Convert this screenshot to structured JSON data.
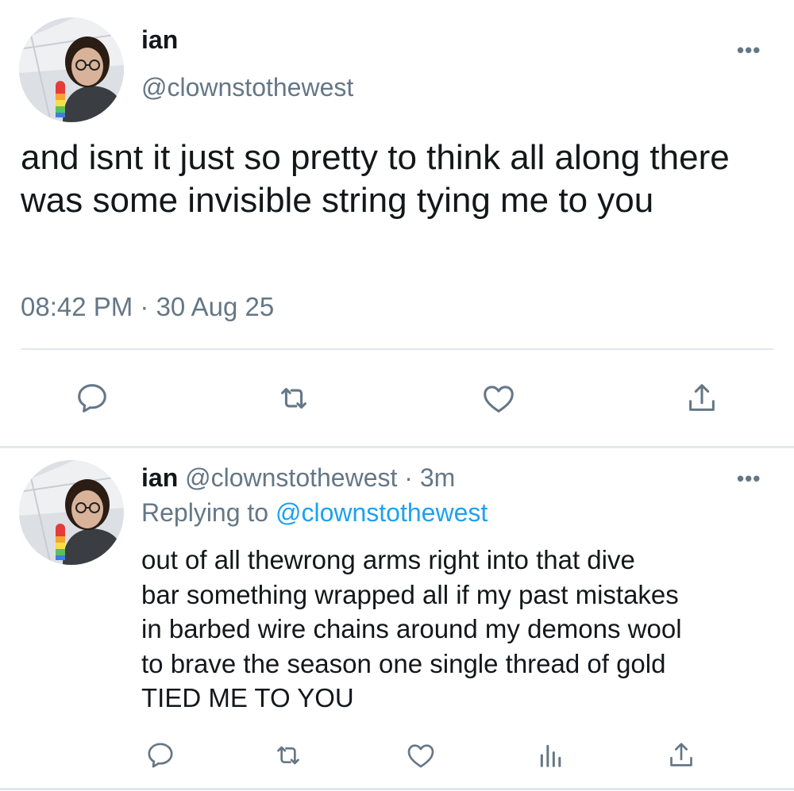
{
  "main_tweet": {
    "display_name": "ian",
    "handle": "@clownstothewest",
    "text": "and isnt it just so pretty to think all along there was some invisible string tying me to you",
    "timestamp": "08:42 PM · 30 Aug 25",
    "more_label": "•••",
    "actions": [
      "reply-icon",
      "retweet-icon",
      "like-icon",
      "share-icon"
    ]
  },
  "reply_tweet": {
    "display_name": "ian",
    "handle": "@clownstothewest",
    "time_ago": "· 3m",
    "replying_prefix": "Replying to",
    "replying_to": "@clownstothewest",
    "text_lines": [
      "out of all thewrong arms right into that dive",
      "bar something wrapped all if my past mistakes",
      "in barbed wire chains around my demons wool",
      "to brave the season one single thread of gold",
      "TIED ME TO YOU"
    ],
    "more_label": "•••",
    "actions": [
      "reply-icon",
      "retweet-icon",
      "like-icon",
      "analytics-icon",
      "share-icon"
    ]
  },
  "colors": {
    "text": "#14171a",
    "secondary": "#657786",
    "link": "#1da1f2",
    "divider": "#e1e8ed"
  }
}
